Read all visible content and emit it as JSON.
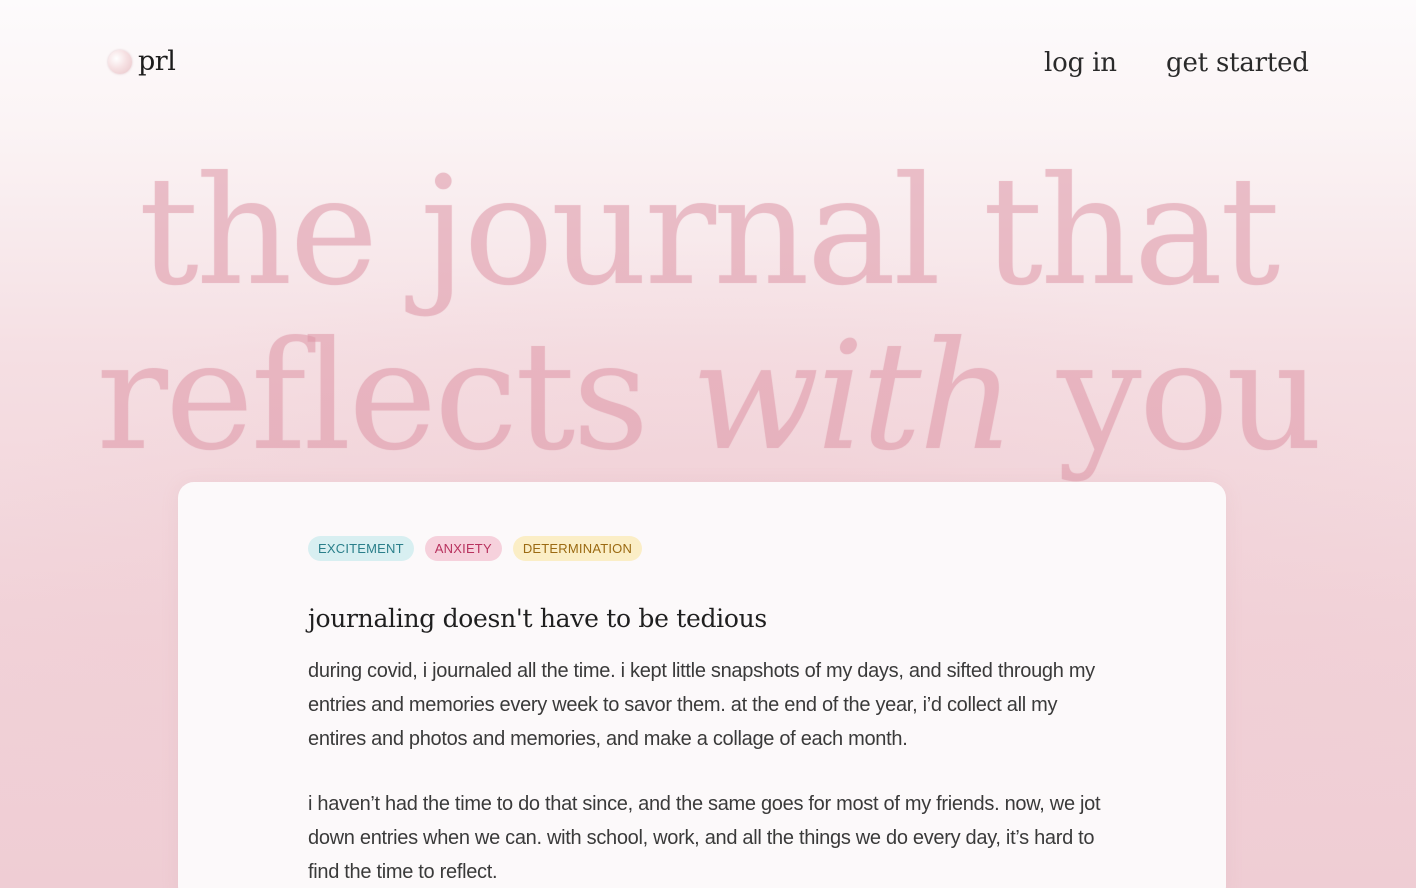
{
  "nav": {
    "logo_text": "prl",
    "login_label": "log in",
    "get_started_label": "get started"
  },
  "hero": {
    "line1": "the journal that",
    "line2_start": "reflects",
    "line2_em": "with",
    "line2_end": "you"
  },
  "entry": {
    "tags": [
      "EXCITEMENT",
      "ANXIETY",
      "DETERMINATION"
    ],
    "title": "journaling doesn't have to be tedious",
    "paragraphs": [
      "during covid, i journaled all the time. i kept little snapshots of my days, and sifted through my entries and memories every week to savor them. at the end of the year, i’d collect all my entires and photos and memories, and make a collage of each month.",
      "i haven’t had the time to do that since, and the same goes for most of my friends. now, we jot down entries when we can. with school, work, and all the things we do every day, it’s hard to find the time to reflect."
    ]
  },
  "colors": {
    "hero_text": "#de96a6",
    "tag_excitement_bg": "#d8eff1",
    "tag_anxiety_bg": "#f6d1dc",
    "tag_determination_bg": "#fbeec6"
  },
  "icons": {
    "logo": "pearl-logo-icon"
  }
}
